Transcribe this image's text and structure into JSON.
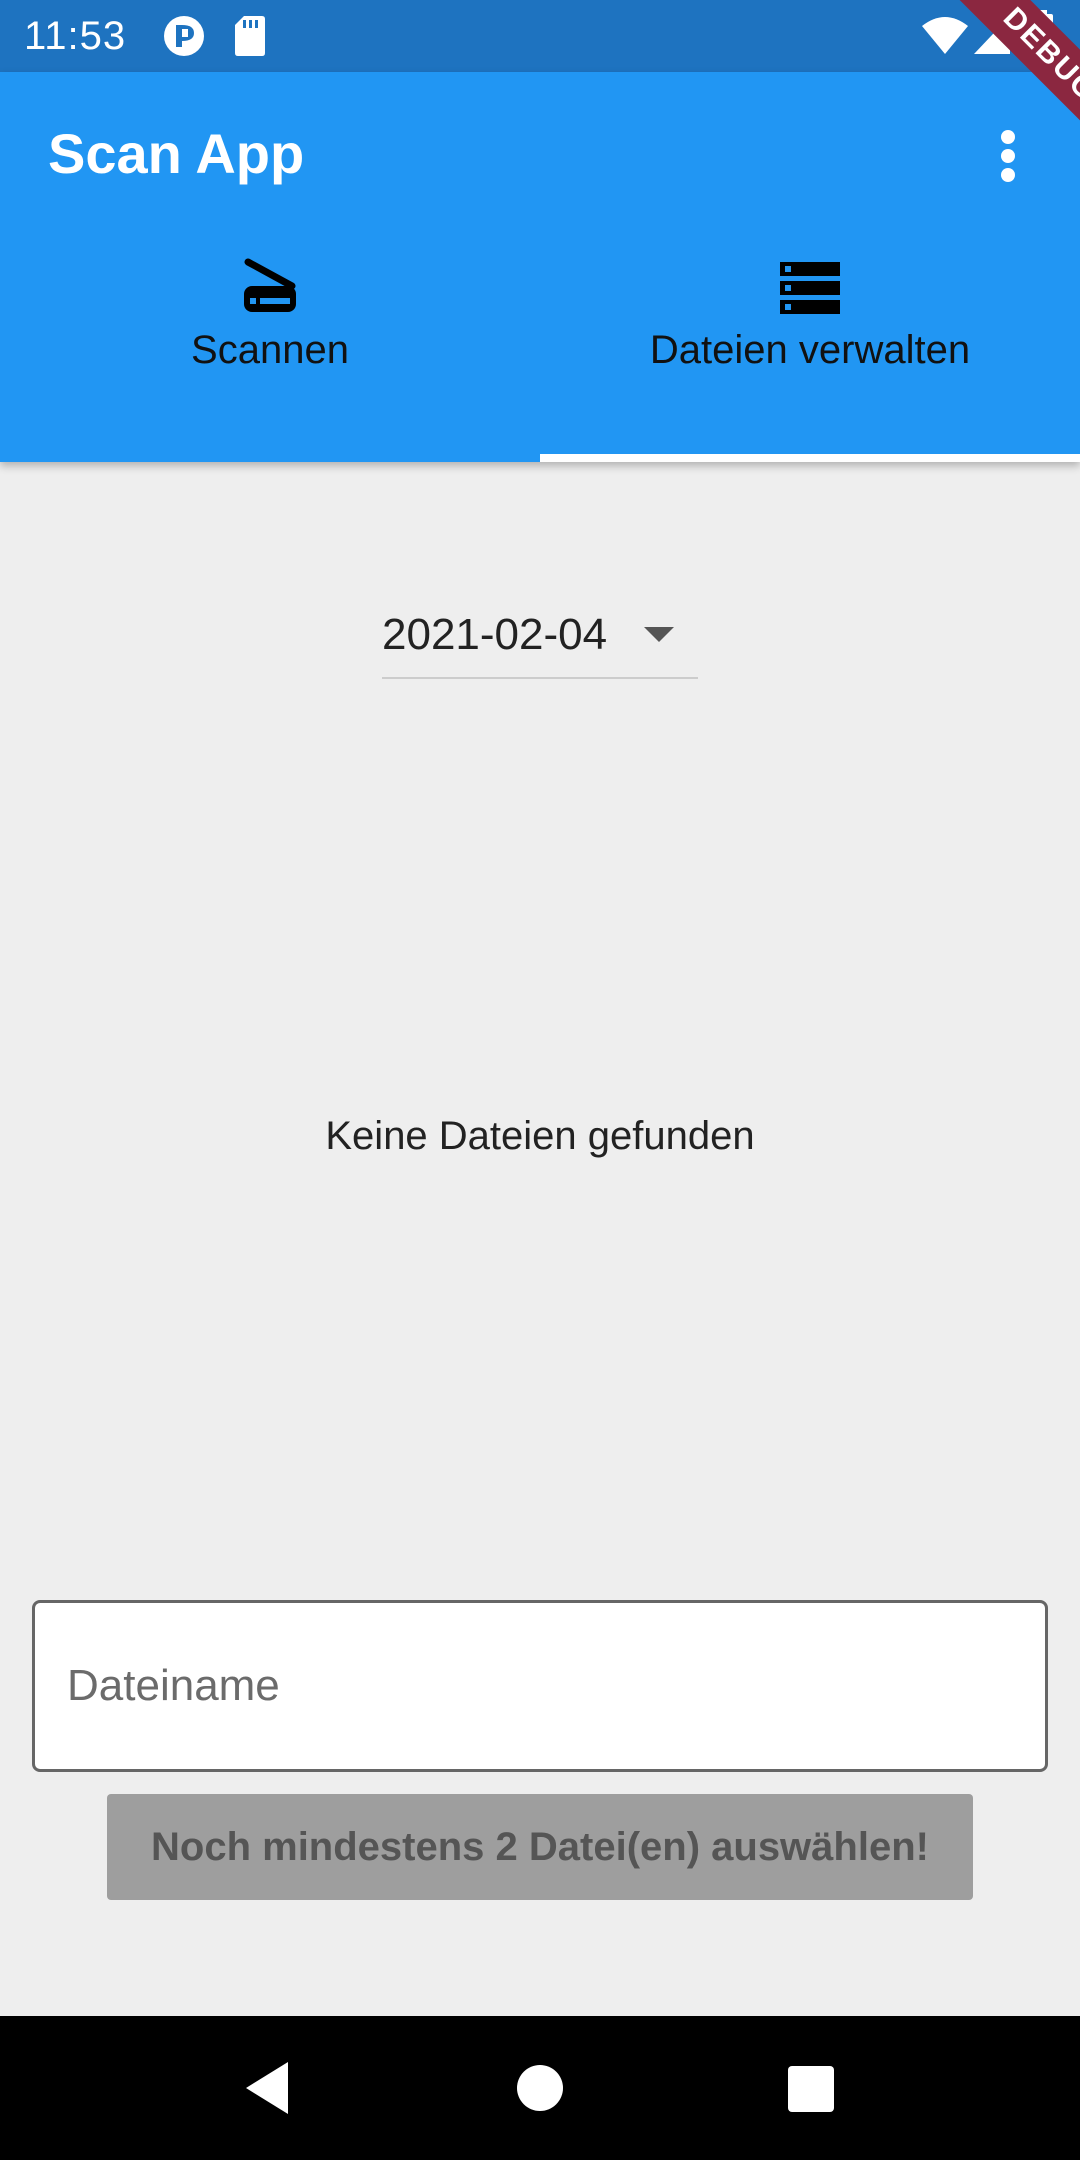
{
  "status_bar": {
    "time": "11:53",
    "icons": [
      "app-notification-icon",
      "sd-card-icon",
      "wifi-icon",
      "signal-icon",
      "battery-icon"
    ]
  },
  "debug_banner": "DEBUG",
  "app_bar": {
    "title": "Scan App",
    "overflow_icon": "more-vert-icon",
    "background_color": "#2196f3"
  },
  "tabs": [
    {
      "label": "Scannen",
      "icon": "scanner-icon",
      "selected": false
    },
    {
      "label": "Dateien verwalten",
      "icon": "storage-icon",
      "selected": true
    }
  ],
  "date_dropdown": {
    "value": "2021-02-04"
  },
  "empty_state": "Keine Dateien gefunden",
  "filename_input": {
    "placeholder": "Dateiname",
    "value": ""
  },
  "merge_button": {
    "label": "Noch mindestens 2 Datei(en) auswählen!",
    "enabled": false
  },
  "nav_bar": [
    "back-icon",
    "home-icon",
    "recents-icon"
  ]
}
